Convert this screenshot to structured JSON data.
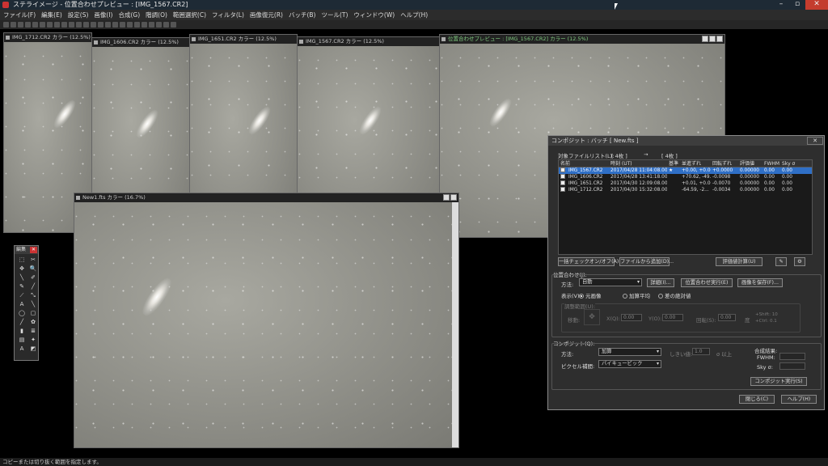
{
  "app": {
    "title": "ステライメージ - 位置合わせプレビュー : [IMG_1567.CR2]",
    "status": "コピーまたは切り抜く範囲を指定します。"
  },
  "menu": [
    "ファイル(F)",
    "編集(E)",
    "設定(S)",
    "画像(I)",
    "合成(G)",
    "階調(O)",
    "範囲選択(C)",
    "フィルタ(L)",
    "画像復元(R)",
    "バッチ(B)",
    "ツール(T)",
    "ウィンドウ(W)",
    "ヘルプ(H)"
  ],
  "windows": {
    "w1": "IMG_1712.CR2 カラー (12.5%)",
    "w2": "IMG_1606.CR2 カラー (12.5%)",
    "w3": "IMG_1651.CR2 カラー (12.5%)",
    "w4": "IMG_1567.CR2 カラー (12.5%)",
    "preview": "位置合わせプレビュー : [IMG_1567.CR2] カラー (12.5%)",
    "new1": "New1.fts カラー (16.7%)"
  },
  "palette": {
    "title": "編集",
    "tools": [
      "⬚",
      "✂",
      "✥",
      "🔍",
      "╲",
      "✐",
      "✎",
      "╱",
      "⟋",
      "⤡",
      "A",
      "╲",
      "◯",
      "▢",
      "╱",
      "✿",
      "▮",
      "≣",
      "▤",
      "✦",
      "A",
      "◩"
    ]
  },
  "dialog": {
    "title": "コンポジット : バッチ [ New.fts ]",
    "file_list_label": "対象ファイルリスト(L):",
    "count_left": "[ 4枚 ]",
    "arrow": "→",
    "count_right": "[ 4枚 ]",
    "columns": [
      "名前",
      "時刻 (UT)",
      "基準",
      "並進ずれ",
      "回転ずれ",
      "評価値",
      "FWHM",
      "Sky σ"
    ],
    "rows": [
      {
        "name": "IMG_1567.CR2",
        "time": "2017/04/28 11:04:08.00",
        "ref": "★",
        "shift": "+0.00, +0.00",
        "rot": "+0.0000",
        "eval": "0.00000",
        "fwhm": "0.00",
        "sky": "0.00"
      },
      {
        "name": "IMG_1606.CR2",
        "time": "2017/04/28 13:41:18.00",
        "ref": "",
        "shift": "+70.62, -49.",
        "rot": "-0.0098",
        "eval": "0.00000",
        "fwhm": "0.00",
        "sky": "0.00"
      },
      {
        "name": "IMG_1651.CR2",
        "time": "2017/04/30 12:09:08.00",
        "ref": "",
        "shift": "+0.01, +0.00",
        "rot": "-0.0070",
        "eval": "0.00000",
        "fwhm": "0.00",
        "sky": "0.00"
      },
      {
        "name": "IMG_1712.CR2",
        "time": "2017/04/30 15:32:08.00",
        "ref": "",
        "shift": "-64.59, -2...",
        "rot": "-0.0034",
        "eval": "0.00000",
        "fwhm": "0.00",
        "sky": "0.00"
      }
    ],
    "btn_check_all": "一括チェックオン/オフ(A)",
    "btn_add_file": "ファイルから追加(D)...",
    "btn_calc_eval": "評価値計算(U)",
    "align_label": "位置合わせ(J):",
    "method_label": "方法:",
    "method_value": "自動",
    "btn_detail": "詳細(I)...",
    "btn_run_align": "位置合わせ実行(E)",
    "btn_save_image": "画像を保存(F)...",
    "display_label": "表示(V):",
    "radio_original": "元画像",
    "radio_average": "加算平均",
    "radio_abs_diff": "差の絶対値",
    "range_label": "調整範囲(U):",
    "move_label": "移動:",
    "xq_label": "X(Q):",
    "x_val": "0.00",
    "y_label": "Y(O):",
    "y_val": "0.00",
    "rot_label": "回転(S):",
    "rot_val": "0.00",
    "deg": "度",
    "shift_hint": "+Shift: 10",
    "ctrl_hint": "+Ctrl: 0.1",
    "composite_label": "コンポジット(Q):",
    "comp_method_label": "方法:",
    "comp_method_value": "加算",
    "threshold_label": "しきい値:",
    "threshold_value": "1.0",
    "sigma_label": "σ 以上",
    "interp_label": "ピクセル補間:",
    "interp_value": "バイキュービック",
    "result_label": "合成結果:",
    "fwhm_label": "FWHM:",
    "sky_label": "Sky σ:",
    "btn_run_comp": "コンポジット実行(S)",
    "btn_close": "閉じる(C)",
    "btn_help": "ヘルプ(H)"
  }
}
